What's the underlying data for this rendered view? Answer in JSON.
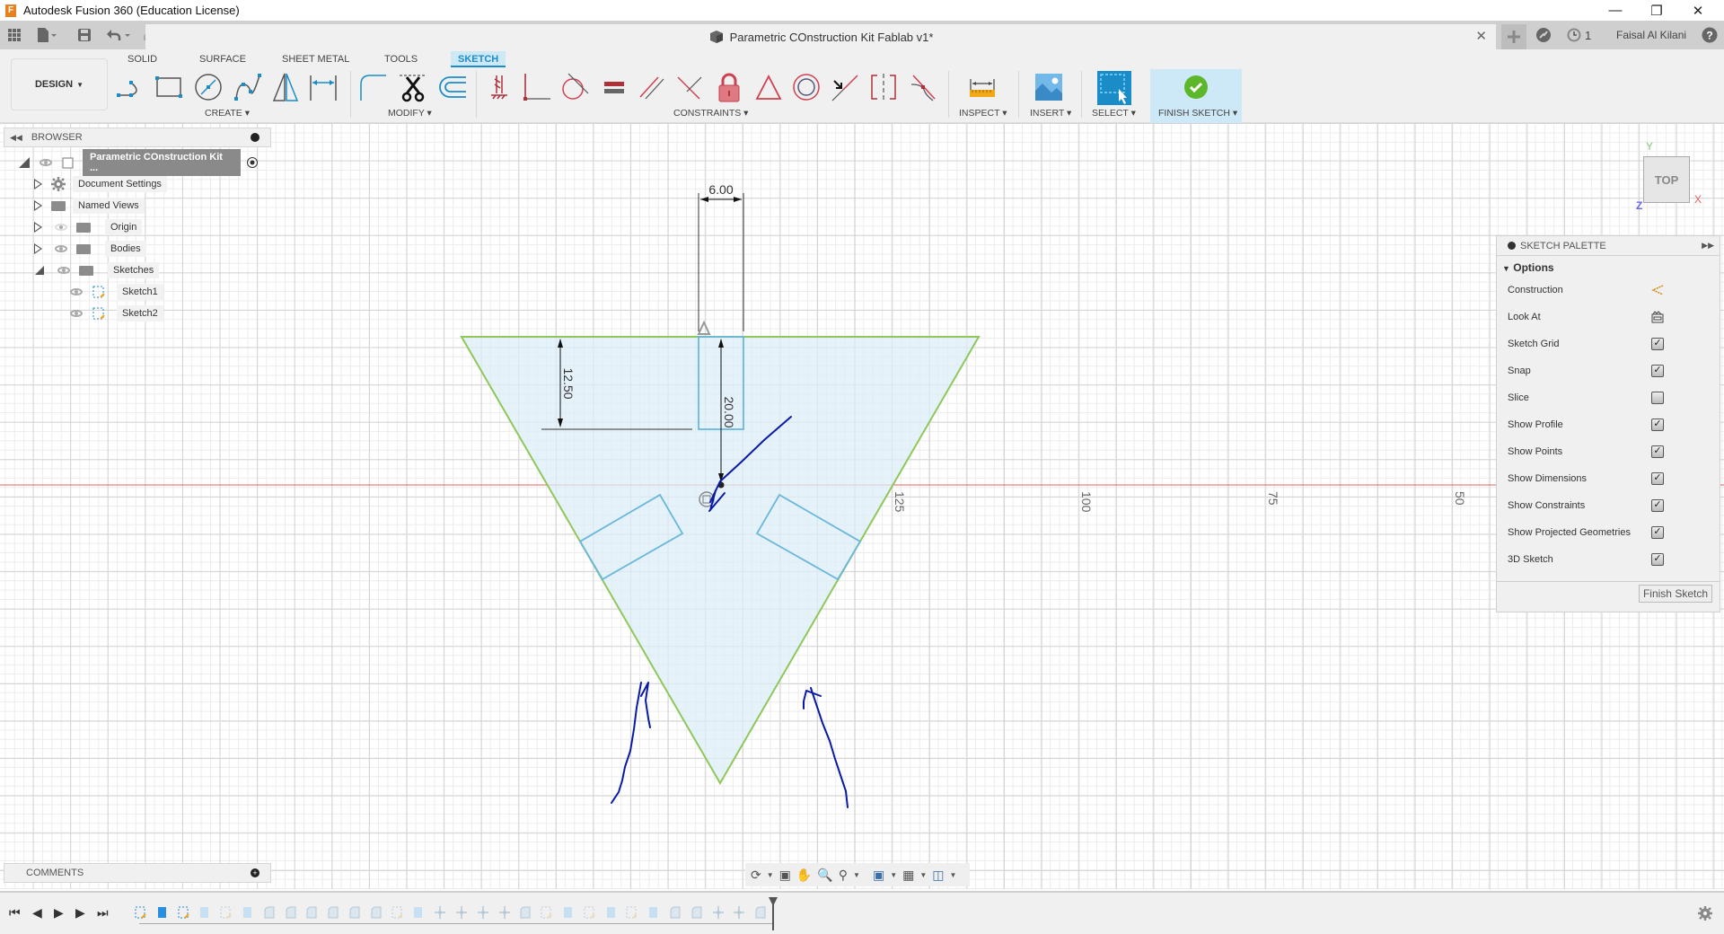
{
  "window": {
    "title": "Autodesk Fusion 360 (Education License)",
    "controls": [
      "minimize",
      "restore",
      "close"
    ]
  },
  "document": {
    "tab_title": "Parametric COnstruction Kit Fablab v1*",
    "jobs_count": "1",
    "user_name": "Faisal Al Kilani"
  },
  "ribbon": {
    "workspace": "DESIGN",
    "tabs": [
      {
        "label": "SOLID",
        "active": false
      },
      {
        "label": "SURFACE",
        "active": false
      },
      {
        "label": "SHEET METAL",
        "active": false
      },
      {
        "label": "TOOLS",
        "active": false
      },
      {
        "label": "SKETCH",
        "active": true
      }
    ],
    "groups": {
      "create": "CREATE ▾",
      "modify": "MODIFY ▾",
      "constraints": "CONSTRAINTS ▾",
      "inspect": "INSPECT ▾",
      "insert": "INSERT ▾",
      "select": "SELECT ▾",
      "finish": "FINISH SKETCH ▾"
    },
    "create_tools": [
      "line",
      "rectangle",
      "circle",
      "spline",
      "mirror",
      "dimension"
    ],
    "modify_tools": [
      "fillet",
      "trim",
      "offset"
    ],
    "constraint_tools": [
      "horizontal-vertical",
      "coincident",
      "tangent",
      "equal",
      "parallel",
      "perpendicular",
      "fix",
      "midpoint",
      "concentric",
      "collinear",
      "symmetric",
      "curvature"
    ]
  },
  "browser": {
    "title": "BROWSER",
    "root": "Parametric COnstruction Kit ...",
    "items": [
      {
        "label": "Document Settings",
        "icon": "gear-icon",
        "expanded": false
      },
      {
        "label": "Named Views",
        "icon": "folder-icon",
        "expanded": false
      },
      {
        "label": "Origin",
        "icon": "folder-icon",
        "expanded": false,
        "visible": false
      },
      {
        "label": "Bodies",
        "icon": "folder-icon",
        "expanded": false,
        "visible": true
      },
      {
        "label": "Sketches",
        "icon": "folder-icon",
        "expanded": true,
        "visible": true
      }
    ],
    "sketches": [
      "Sketch1",
      "Sketch2"
    ]
  },
  "comments": {
    "title": "COMMENTS"
  },
  "viewcube": {
    "face": "TOP",
    "axis_x": "X",
    "axis_y": "Y",
    "axis_z": "Z"
  },
  "sketch": {
    "dimensions": {
      "slot_width": "6.00",
      "slot_depth": "12.50",
      "center_offset": "20.00"
    },
    "axis_labels": [
      "125",
      "100",
      "75",
      "50"
    ]
  },
  "sketch_palette": {
    "title": "SKETCH PALETTE",
    "section": "Options",
    "options": [
      {
        "label": "Construction",
        "type": "icon",
        "icon": "construction-icon"
      },
      {
        "label": "Look At",
        "type": "icon",
        "icon": "look-at-icon"
      },
      {
        "label": "Sketch Grid",
        "type": "checkbox",
        "checked": true
      },
      {
        "label": "Snap",
        "type": "checkbox",
        "checked": true
      },
      {
        "label": "Slice",
        "type": "checkbox",
        "checked": false
      },
      {
        "label": "Show Profile",
        "type": "checkbox",
        "checked": true
      },
      {
        "label": "Show Points",
        "type": "checkbox",
        "checked": true
      },
      {
        "label": "Show Dimensions",
        "type": "checkbox",
        "checked": true
      },
      {
        "label": "Show Constraints",
        "type": "checkbox",
        "checked": true
      },
      {
        "label": "Show Projected Geometries",
        "type": "checkbox",
        "checked": true
      },
      {
        "label": "3D Sketch",
        "type": "checkbox",
        "checked": true
      }
    ],
    "finish_button": "Finish Sketch"
  },
  "colors": {
    "accent": "#1a8dc9",
    "profile_fill": "#e3f1fa",
    "triangle_edge": "#8fc75a",
    "slot_edge": "#6ab7dc",
    "annotation_ink": "#0a1aa8",
    "x_axis": "#e06060",
    "finish_green": "#5cb82a"
  }
}
